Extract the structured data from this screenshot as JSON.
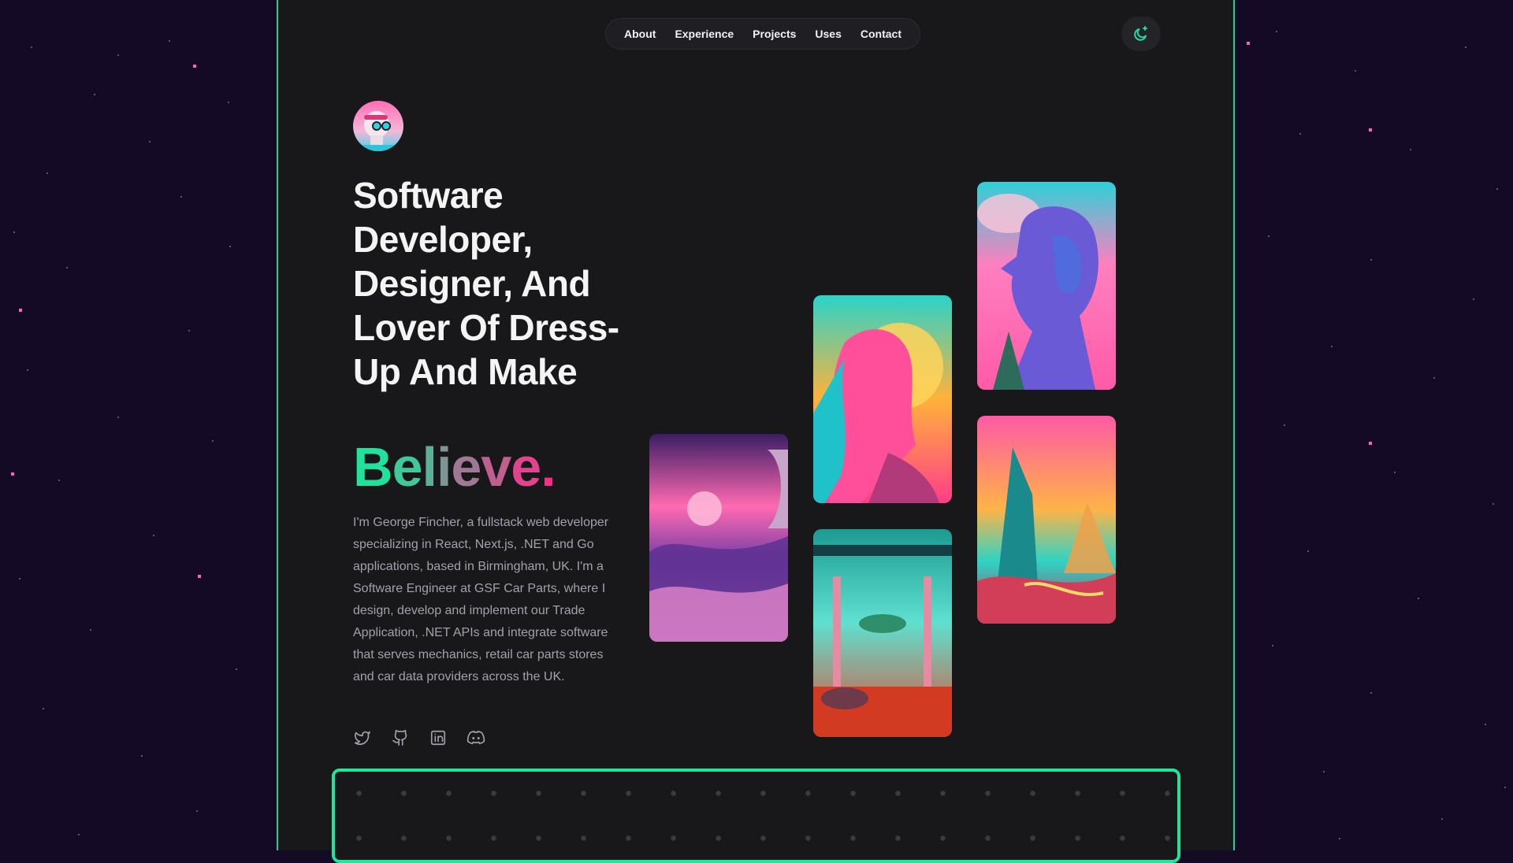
{
  "nav": {
    "items": [
      "About",
      "Experience",
      "Projects",
      "Uses",
      "Contact"
    ]
  },
  "theme_toggle": {
    "icon": "moon-star-icon"
  },
  "hero": {
    "headline": "Software Developer, Designer, And Lover Of Dress-Up And Make",
    "accent_word": "Believe.",
    "intro": "I'm George Fincher, a fullstack web developer specializing in React, Next.js, .NET and Go applications, based in Birmingham, UK. I'm a Software Engineer at GSF Car Parts, where I design, develop and implement our Trade Application, .NET APIs and integrate software that serves mechanics, retail car parts stores and car data providers across the UK."
  },
  "socials": [
    "twitter-icon",
    "github-icon",
    "linkedin-icon",
    "discord-icon"
  ],
  "colors": {
    "accent_green": "#1fe39d",
    "accent_pink": "#ff2a8a",
    "page_bg": "#18181b",
    "space_bg": "#140a26"
  }
}
